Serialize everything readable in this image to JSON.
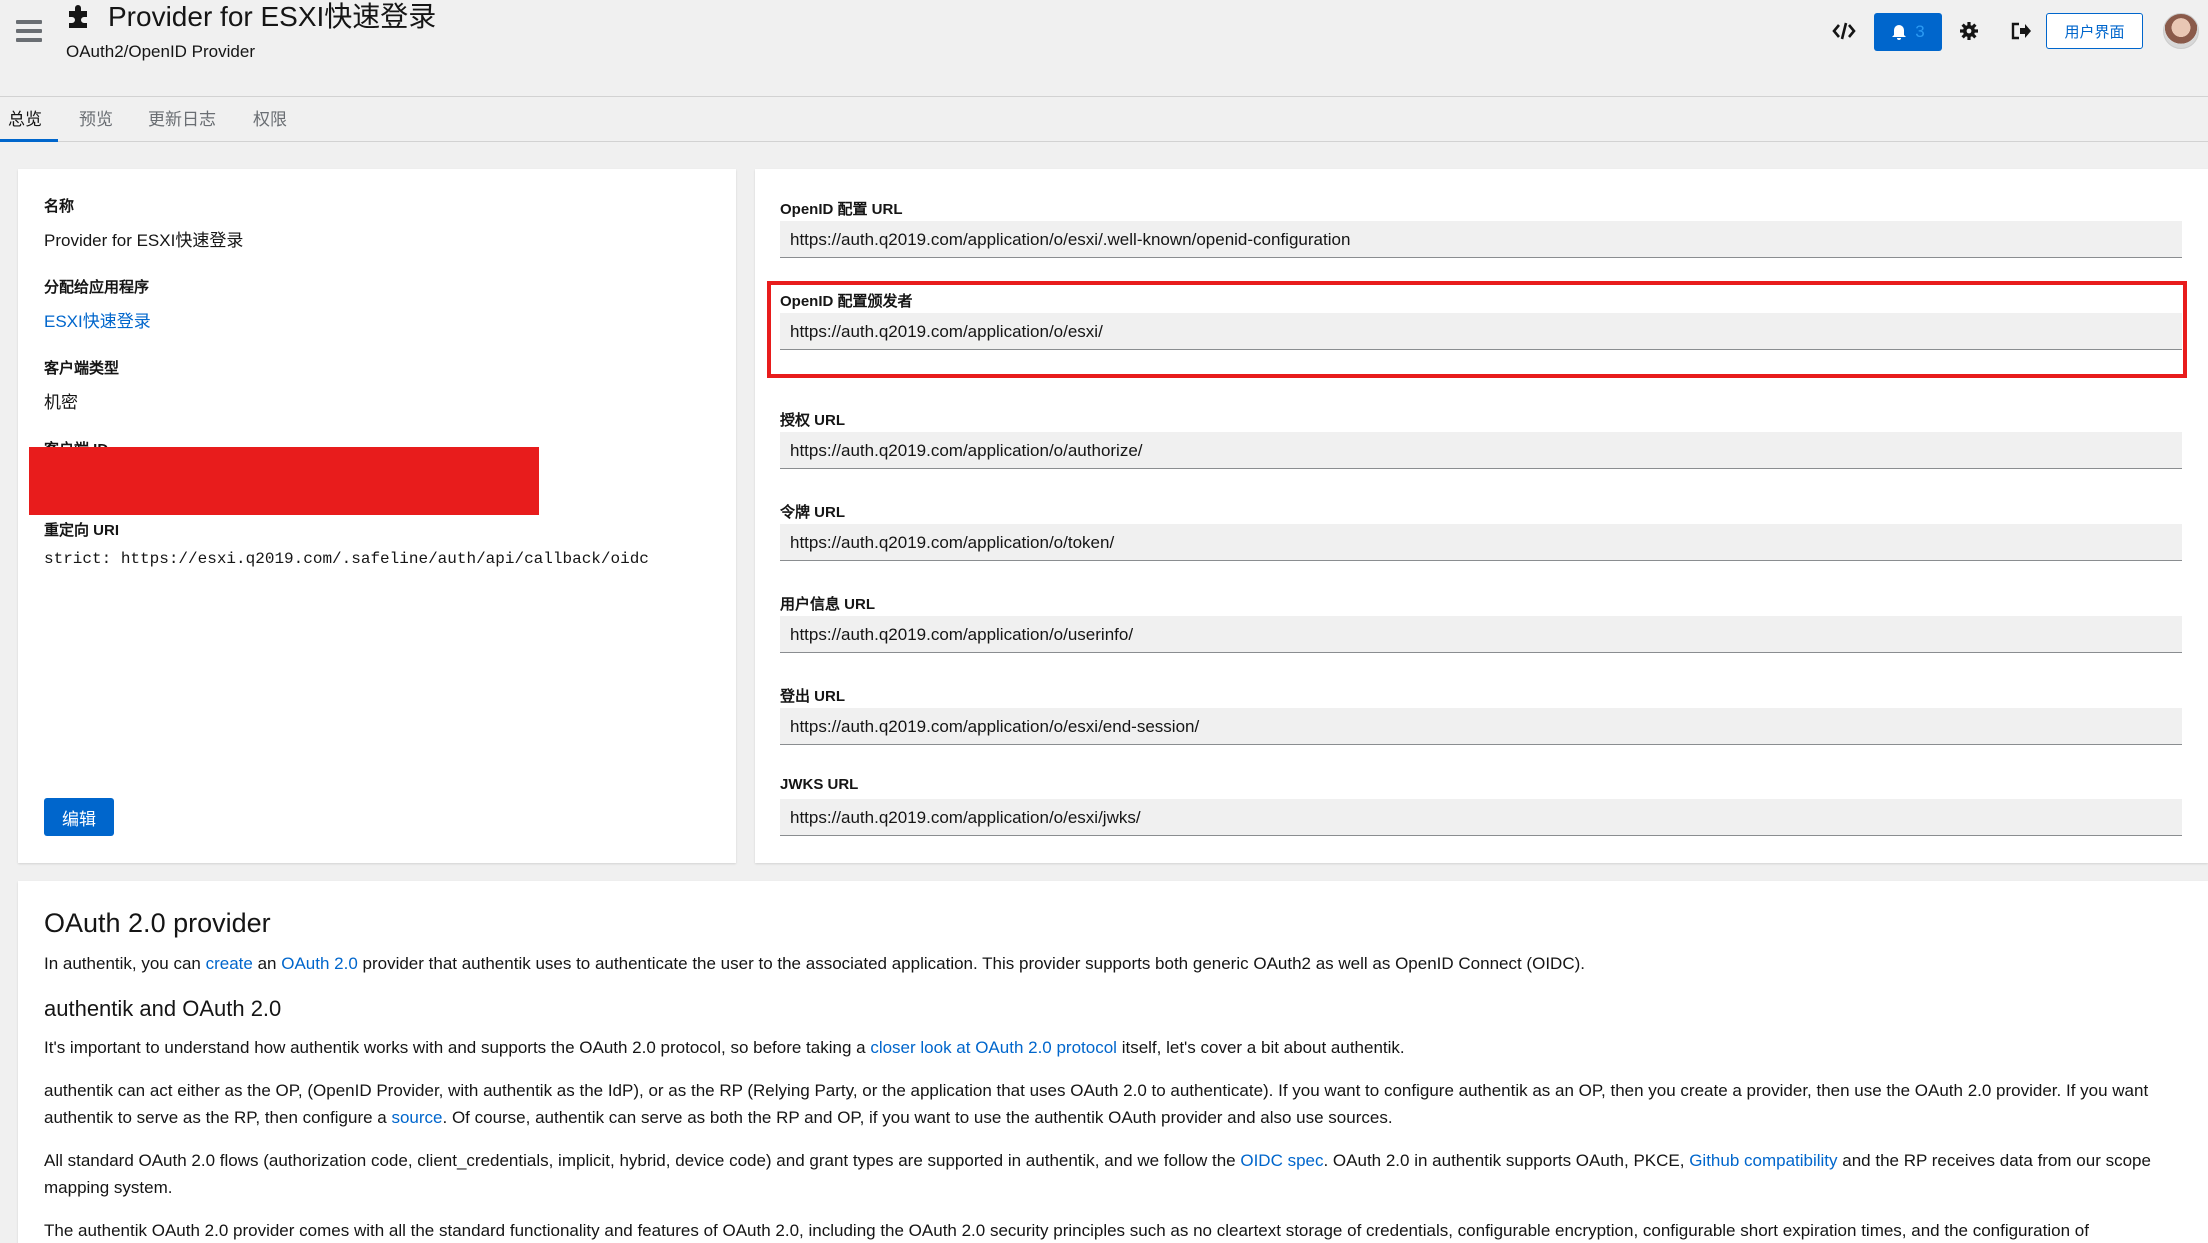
{
  "header": {
    "title": "Provider for ESXI快速登录",
    "subtitle": "OAuth2/OpenID Provider",
    "notification_count": "3",
    "user_ui_label": "用户界面"
  },
  "tabs": [
    {
      "label": "总览",
      "active": true
    },
    {
      "label": "预览",
      "active": false
    },
    {
      "label": "更新日志",
      "active": false
    },
    {
      "label": "权限",
      "active": false
    }
  ],
  "details": {
    "name_label": "名称",
    "name_value": "Provider for ESXI快速登录",
    "assigned_label": "分配给应用程序",
    "assigned_value": "ESXI快速登录",
    "client_type_label": "客户端类型",
    "client_type_value": "机密",
    "client_id_label": "客户端 ID",
    "redirect_label": "重定向 URI",
    "redirect_value": "strict: https://esxi.q2019.com/.safeline/auth/api/callback/oidc",
    "edit_label": "编辑"
  },
  "urls": [
    {
      "label": "OpenID 配置 URL",
      "value": "https://auth.q2019.com/application/o/esxi/.well-known/openid-configuration"
    },
    {
      "label": "OpenID 配置颁发者",
      "value": "https://auth.q2019.com/application/o/esxi/"
    },
    {
      "label": "授权 URL",
      "value": "https://auth.q2019.com/application/o/authorize/"
    },
    {
      "label": "令牌 URL",
      "value": "https://auth.q2019.com/application/o/token/"
    },
    {
      "label": "用户信息 URL",
      "value": "https://auth.q2019.com/application/o/userinfo/"
    },
    {
      "label": "登出 URL",
      "value": "https://auth.q2019.com/application/o/esxi/end-session/"
    },
    {
      "label": "JWKS URL",
      "value": "https://auth.q2019.com/application/o/esxi/jwks/"
    }
  ],
  "docs": {
    "h1": "OAuth 2.0 provider",
    "p1_a": "In authentik, you can ",
    "p1_link1": "create",
    "p1_b": " an ",
    "p1_link2": "OAuth 2.0",
    "p1_c": " provider that authentik uses to authenticate the user to the associated application. This provider supports both generic OAuth2 as well as OpenID Connect (OIDC).",
    "h2": "authentik and OAuth 2.0",
    "p2_a": "It's important to understand how authentik works with and supports the OAuth 2.0 protocol, so before taking a ",
    "p2_link": "closer look at OAuth 2.0 protocol",
    "p2_b": " itself, let's cover a bit about authentik.",
    "p3_a": "authentik can act either as the OP, (OpenID Provider, with authentik as the IdP), or as the RP (Relying Party, or the application that uses OAuth 2.0 to authenticate). If you want to configure authentik as an OP, then you create a provider, then use the OAuth 2.0 provider. If you want authentik to serve as the RP, then configure a ",
    "p3_link": "source",
    "p3_b": ". Of course, authentik can serve as both the RP and OP, if you want to use the authentik OAuth provider and also use sources.",
    "p4_a": "All standard OAuth 2.0 flows (authorization code, client_credentials, implicit, hybrid, device code) and grant types are supported in authentik, and we follow the ",
    "p4_link1": "OIDC spec",
    "p4_b": ". OAuth 2.0 in authentik supports OAuth, PKCE, ",
    "p4_link2": "Github compatibility",
    "p4_c": " and the RP receives data from our scope mapping system.",
    "p5": "The authentik OAuth 2.0 provider comes with all the standard functionality and features of OAuth 2.0, including the OAuth 2.0 security principles such as no cleartext storage of credentials, configurable encryption, configurable short expiration times, and the configuration of"
  }
}
